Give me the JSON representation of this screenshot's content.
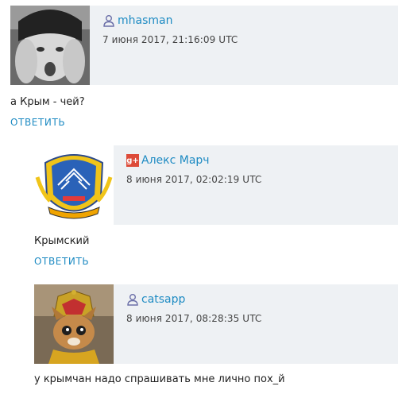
{
  "comments": [
    {
      "author": "mhasman",
      "author_icon": "user-icon",
      "date": "7 июня 2017, 21:16:09 UTC",
      "text": "а Крым - чей?",
      "reply_label": "ОТВЕТИТЬ"
    },
    {
      "author": "Алекс Марч",
      "author_icon": "google-plus-icon",
      "date": "8 июня 2017, 02:02:19 UTC",
      "text": "Крымский",
      "reply_label": "ОТВЕТИТЬ"
    },
    {
      "author": "catsapp",
      "author_icon": "user-icon",
      "date": "8 июня 2017, 08:28:35 UTC",
      "text": "у крымчан надо спрашивать мне лично пох_й"
    }
  ],
  "colors": {
    "link": "#1e8bc3",
    "header_bg": "#eef1f4",
    "gplus": "#dd4b39"
  }
}
